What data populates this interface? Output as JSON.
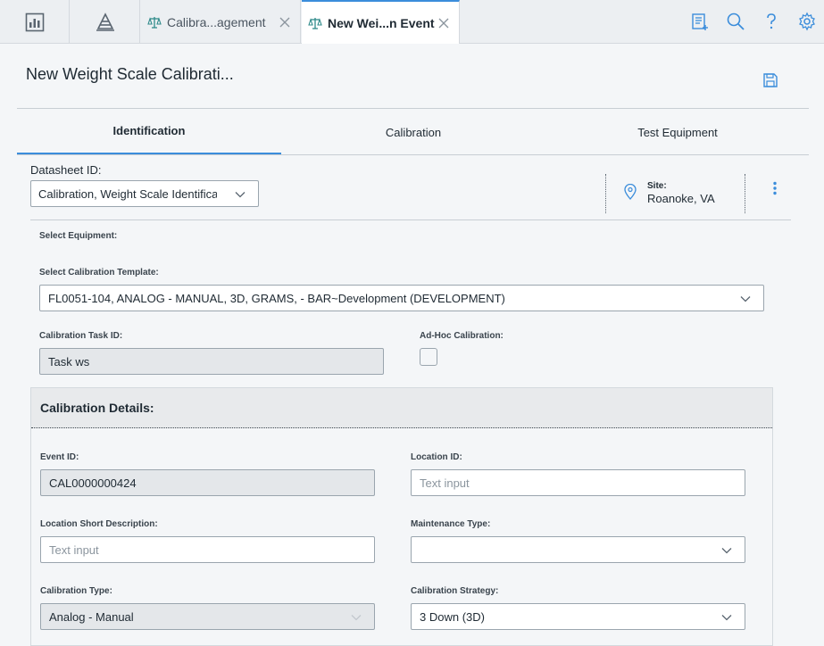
{
  "topbar": {
    "tabs": [
      {
        "label": "Calibra...agement",
        "icon": "scale-icon",
        "active": false
      },
      {
        "label": "New Wei...n Event",
        "icon": "scale-icon",
        "active": true
      }
    ],
    "left_icons": [
      "dashboard-icon",
      "asset-hierarchy-icon"
    ],
    "right_icons": [
      "add-report-icon",
      "search-icon",
      "help-icon",
      "settings-icon"
    ]
  },
  "page": {
    "title": "New Weight Scale Calibrati..."
  },
  "section_tabs": [
    {
      "label": "Identification",
      "active": true
    },
    {
      "label": "Calibration",
      "active": false
    },
    {
      "label": "Test Equipment",
      "active": false
    }
  ],
  "datasheet": {
    "label": "Datasheet ID:",
    "value": "Calibration, Weight Scale Identification"
  },
  "site": {
    "label": "Site:",
    "value": "Roanoke, VA"
  },
  "form": {
    "select_equipment_label": "Select Equipment:",
    "template_label": "Select Calibration Template:",
    "template_value": "FL0051-104, ANALOG - MANUAL, 3D, GRAMS,  - BAR~Development (DEVELOPMENT)",
    "task_id_label": "Calibration Task ID:",
    "task_id_value": "Task ws",
    "adhoc_label": "Ad-Hoc Calibration:"
  },
  "details": {
    "title": "Calibration Details:",
    "event_id_label": "Event ID:",
    "event_id_value": "CAL0000000424",
    "location_id_label": "Location ID:",
    "location_id_placeholder": "Text input",
    "loc_short_desc_label": "Location Short Description:",
    "loc_short_desc_placeholder": "Text input",
    "maint_type_label": "Maintenance Type:",
    "maint_type_value": "",
    "cal_type_label": "Calibration Type:",
    "cal_type_value": "Analog - Manual",
    "cal_strategy_label": "Calibration Strategy:",
    "cal_strategy_value": "3 Down (3D)"
  },
  "colors": {
    "accent": "#3b8ddb",
    "tab_icon": "#2f8a8a"
  }
}
